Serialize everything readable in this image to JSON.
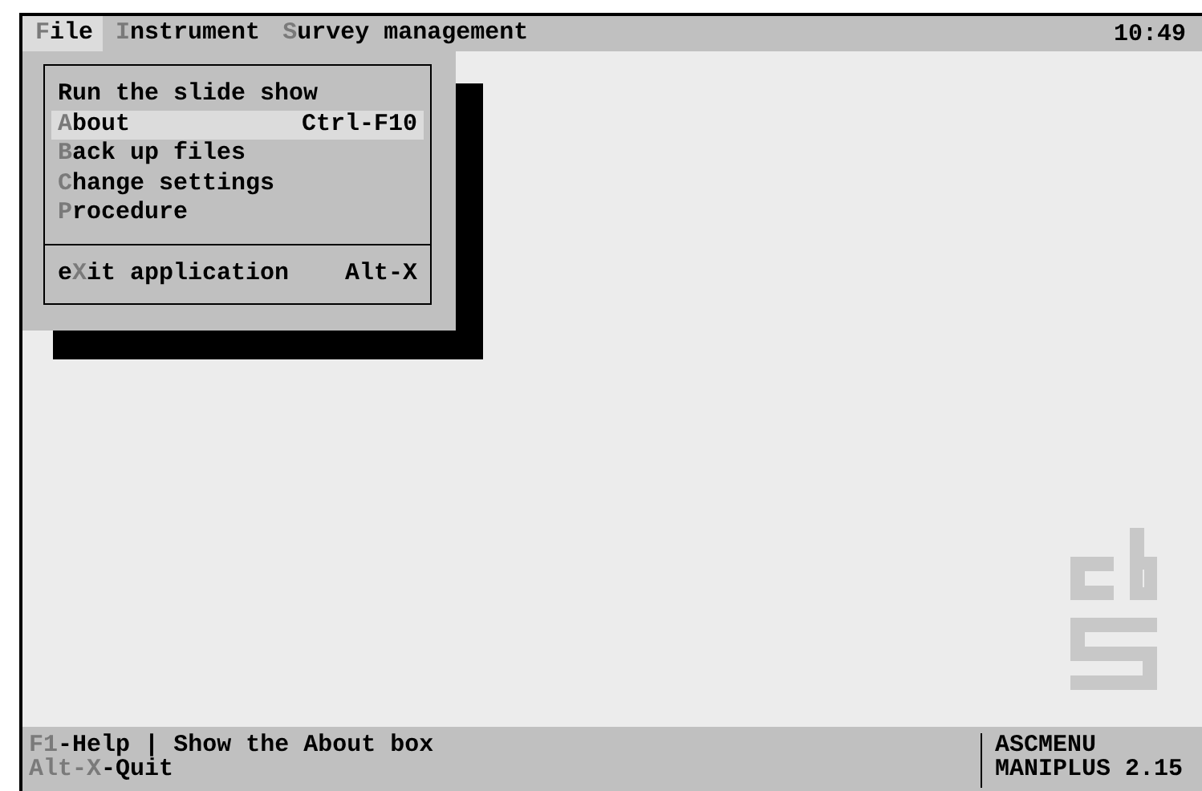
{
  "menu_bar": {
    "items": [
      {
        "hotkey": "F",
        "rest": "ile",
        "selected": true
      },
      {
        "hotkey": "I",
        "rest": "nstrument",
        "selected": false
      },
      {
        "hotkey": "S",
        "rest": "urvey management",
        "selected": false
      }
    ],
    "clock": "10:49"
  },
  "file_menu": {
    "groups": [
      [
        {
          "rest": "Run the slide show",
          "selected": false
        },
        {
          "hotkey": "A",
          "rest": "bout",
          "shortcut": "Ctrl-F10",
          "selected": true
        },
        {
          "hotkey": "B",
          "rest": "ack up files",
          "selected": false
        },
        {
          "hotkey": "C",
          "rest": "hange settings",
          "selected": false
        },
        {
          "hotkey": "P",
          "rest": "rocedure",
          "selected": false
        }
      ],
      [
        {
          "prefix": "e",
          "hotkey": "X",
          "rest": "it application",
          "shortcut": "Alt-X",
          "selected": false
        }
      ]
    ]
  },
  "status_bar": {
    "keys": [
      {
        "hotkey": "F1",
        "rest": "-Help"
      },
      {
        "hotkey": "Alt-X",
        "rest": "-Quit"
      }
    ],
    "separator": "|",
    "hint": "Show the About box",
    "module": "ASCMENU",
    "version": "MANIPLUS 2.15"
  }
}
